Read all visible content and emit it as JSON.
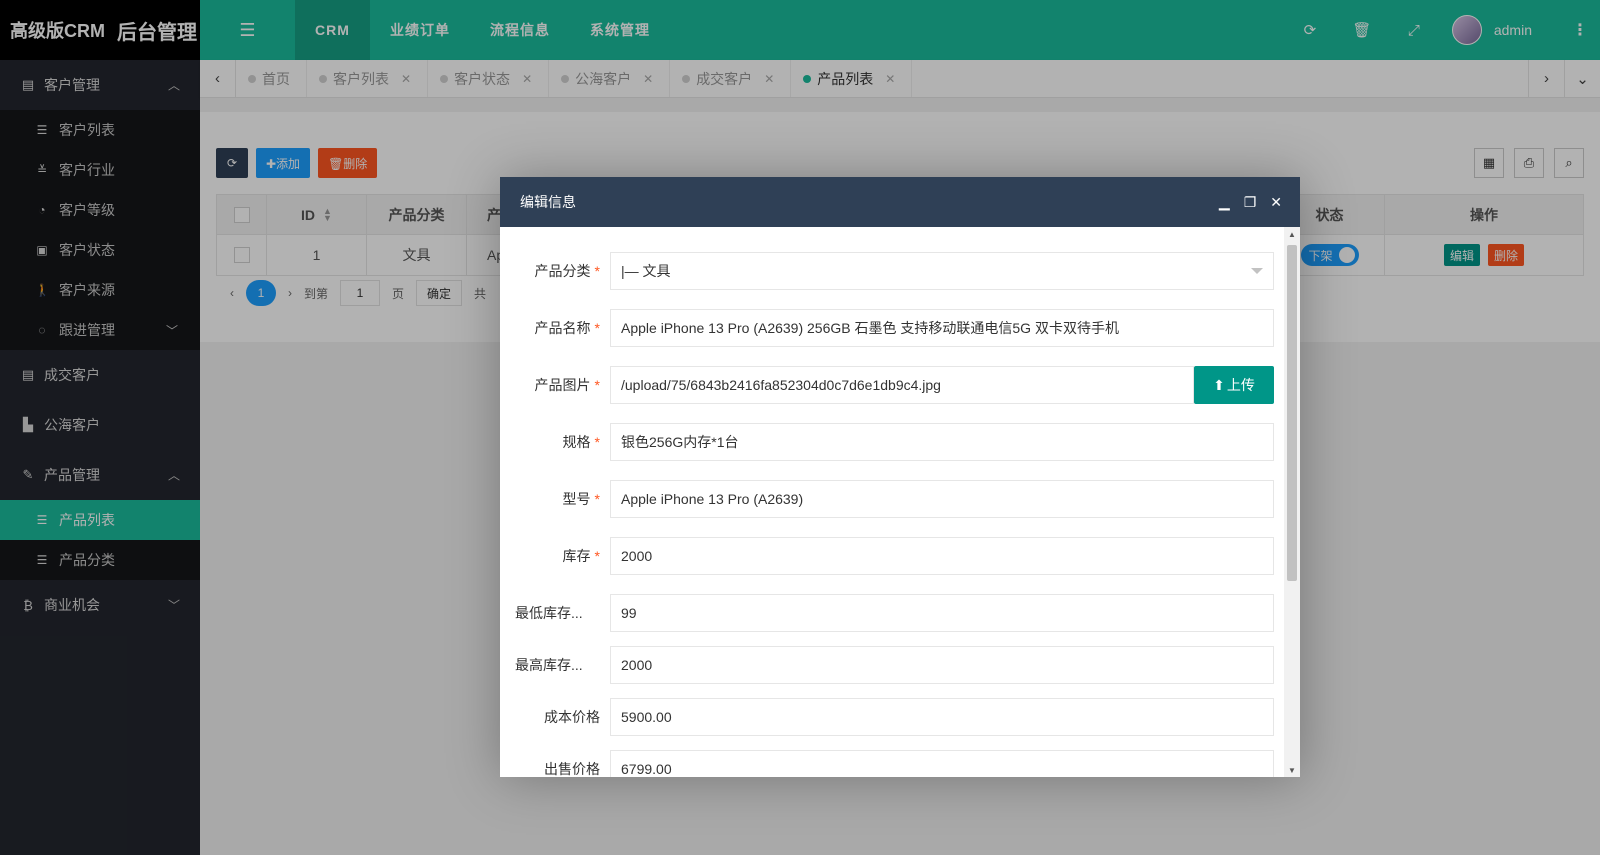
{
  "logo": {
    "main": "高级版CRM",
    "sub": "后台管理"
  },
  "sidebar": {
    "groups": [
      {
        "label": "客户管理",
        "icon": "id-card-icon",
        "expanded": true,
        "items": [
          {
            "label": "客户列表",
            "icon": "list-icon"
          },
          {
            "label": "客户行业",
            "icon": "industry-icon"
          },
          {
            "label": "客户等级",
            "icon": "gauge-icon"
          },
          {
            "label": "客户状态",
            "icon": "status-card-icon"
          },
          {
            "label": "客户来源",
            "icon": "person-walk-icon"
          },
          {
            "label": "跟进管理",
            "icon": "chat-icon"
          }
        ]
      },
      {
        "label": "成交客户",
        "icon": "id-card-icon"
      },
      {
        "label": "公海客户",
        "icon": "chart-icon"
      },
      {
        "label": "产品管理",
        "icon": "brush-icon",
        "expanded": true,
        "items": [
          {
            "label": "产品列表",
            "icon": "list-icon",
            "active": true
          },
          {
            "label": "产品分类",
            "icon": "list-icon"
          }
        ]
      },
      {
        "label": "商业机会",
        "icon": "bitcoin-icon"
      }
    ]
  },
  "header": {
    "nav": [
      "CRM",
      "业绩订单",
      "流程信息",
      "系统管理"
    ],
    "user": "admin"
  },
  "tabs": [
    {
      "label": "首页",
      "closable": false
    },
    {
      "label": "客户列表",
      "closable": true
    },
    {
      "label": "客户状态",
      "closable": true
    },
    {
      "label": "公海客户",
      "closable": true
    },
    {
      "label": "成交客户",
      "closable": true
    },
    {
      "label": "产品列表",
      "closable": true,
      "active": true
    }
  ],
  "toolbar": {
    "add": "✚添加",
    "delete": "🗑删除"
  },
  "table": {
    "headers": {
      "id": "ID",
      "category": "产品分类",
      "name_partial": "产",
      "status": "状态",
      "actions": "操作"
    },
    "row": {
      "id": "1",
      "category": "文具",
      "name_partial": "Ap",
      "status": "下架",
      "edit": "编辑",
      "delete": "删除"
    }
  },
  "pager": {
    "current": "1",
    "goto": "到第",
    "page_value": "1",
    "page_unit": "页",
    "confirm": "确定",
    "total_partial": "共"
  },
  "modal": {
    "title": "编辑信息",
    "fields": {
      "category": {
        "label": "产品分类",
        "value": "|— 文具"
      },
      "name": {
        "label": "产品名称",
        "value": "Apple iPhone 13 Pro (A2639) 256GB 石墨色 支持移动联通电信5G 双卡双待手机"
      },
      "image": {
        "label": "产品图片",
        "value": "/upload/75/6843b2416fa852304d0c7d6e1db9c4.jpg",
        "button": "上传"
      },
      "spec": {
        "label": "规格",
        "value": "银色256G内存*1台"
      },
      "model": {
        "label": "型号",
        "value": "Apple iPhone 13 Pro (A2639)"
      },
      "stock": {
        "label": "库存",
        "value": "2000"
      },
      "min_stock": {
        "label": "最低库存...",
        "value": "99"
      },
      "max_stock": {
        "label": "最高库存...",
        "value": "2000"
      },
      "cost_price": {
        "label": "成本价格",
        "value": "5900.00"
      },
      "sale_price": {
        "label": "出售价格",
        "value": "6799.00"
      }
    }
  },
  "colors": {
    "primary": "#1abc9c",
    "sidebar": "#23262e",
    "modal_head": "#2f4056",
    "required": "#ff5722"
  }
}
